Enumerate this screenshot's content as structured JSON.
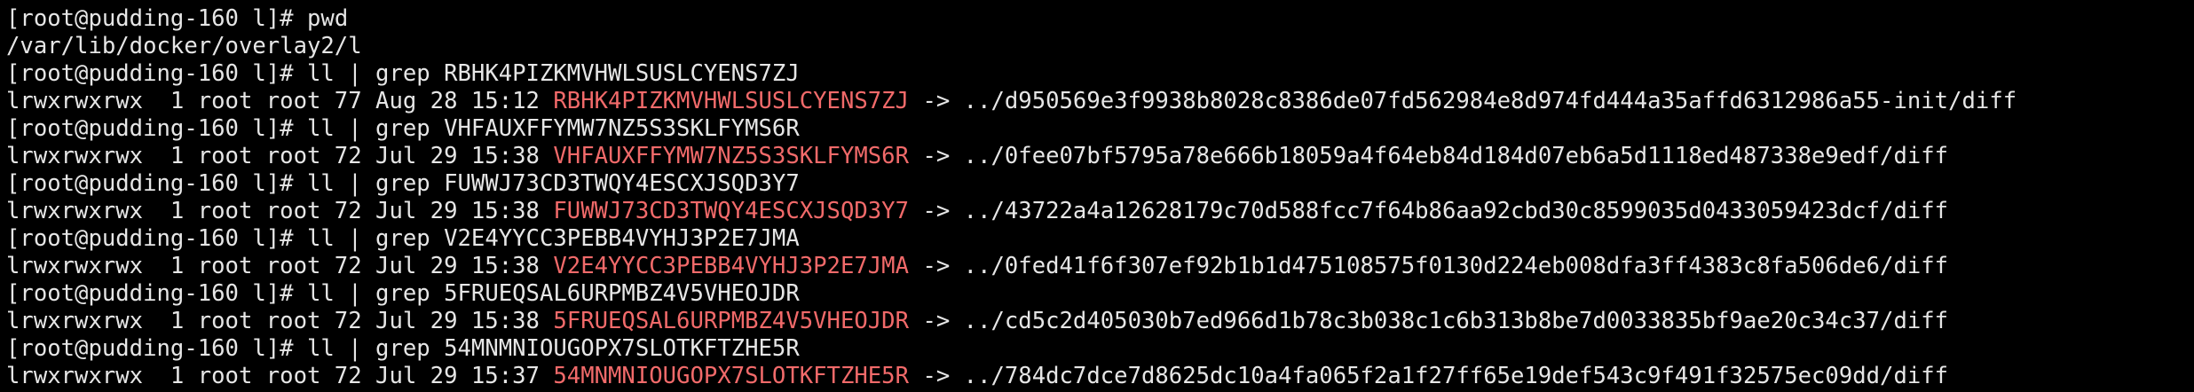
{
  "theme": {
    "background": "#000000",
    "foreground": "#e6e6e6",
    "symlink_color": "#f16a6a"
  },
  "lines": [
    {
      "type": "cmd",
      "prompt": "[root@pudding-160 l]#",
      "command": "pwd"
    },
    {
      "type": "out",
      "text": "/var/lib/docker/overlay2/l"
    },
    {
      "type": "cmd",
      "prompt": "[root@pudding-160 l]#",
      "command": "ll | grep RBHK4PIZKMVHWLSUSLCYENS7ZJ"
    },
    {
      "type": "ls",
      "prefix": "lrwxrwxrwx  1 root root 77 Aug 28 15:12",
      "name": "RBHK4PIZKMVHWLSUSLCYENS7ZJ",
      "target": "-> ../d950569e3f9938b8028c8386de07fd562984e8d974fd444a35affd6312986a55-init/diff"
    },
    {
      "type": "cmd",
      "prompt": "[root@pudding-160 l]#",
      "command": "ll | grep VHFAUXFFYMW7NZ5S3SKLFYMS6R"
    },
    {
      "type": "ls",
      "prefix": "lrwxrwxrwx  1 root root 72 Jul 29 15:38",
      "name": "VHFAUXFFYMW7NZ5S3SKLFYMS6R",
      "target": "-> ../0fee07bf5795a78e666b18059a4f64eb84d184d07eb6a5d1118ed487338e9edf/diff"
    },
    {
      "type": "cmd",
      "prompt": "[root@pudding-160 l]#",
      "command": "ll | grep FUWWJ73CD3TWQY4ESCXJSQD3Y7"
    },
    {
      "type": "ls",
      "prefix": "lrwxrwxrwx  1 root root 72 Jul 29 15:38",
      "name": "FUWWJ73CD3TWQY4ESCXJSQD3Y7",
      "target": "-> ../43722a4a12628179c70d588fcc7f64b86aa92cbd30c8599035d0433059423dcf/diff"
    },
    {
      "type": "cmd",
      "prompt": "[root@pudding-160 l]#",
      "command": "ll | grep V2E4YYCC3PEBB4VYHJ3P2E7JMA"
    },
    {
      "type": "ls",
      "prefix": "lrwxrwxrwx  1 root root 72 Jul 29 15:38",
      "name": "V2E4YYCC3PEBB4VYHJ3P2E7JMA",
      "target": "-> ../0fed41f6f307ef92b1b1d475108575f0130d224eb008dfa3ff4383c8fa506de6/diff"
    },
    {
      "type": "cmd",
      "prompt": "[root@pudding-160 l]#",
      "command": "ll | grep 5FRUEQSAL6URPMBZ4V5VHEOJDR"
    },
    {
      "type": "ls",
      "prefix": "lrwxrwxrwx  1 root root 72 Jul 29 15:38",
      "name": "5FRUEQSAL6URPMBZ4V5VHEOJDR",
      "target": "-> ../cd5c2d405030b7ed966d1b78c3b038c1c6b313b8be7d0033835bf9ae20c34c37/diff"
    },
    {
      "type": "cmd",
      "prompt": "[root@pudding-160 l]#",
      "command": "ll | grep 54MNMNIOUGOPX7SLOTKFTZHE5R"
    },
    {
      "type": "ls",
      "prefix": "lrwxrwxrwx  1 root root 72 Jul 29 15:37",
      "name": "54MNMNIOUGOPX7SLOTKFTZHE5R",
      "target": "-> ../784dc7dce7d8625dc10a4fa065f2a1f27ff65e19def543c9f491f32575ec09dd/diff"
    }
  ]
}
